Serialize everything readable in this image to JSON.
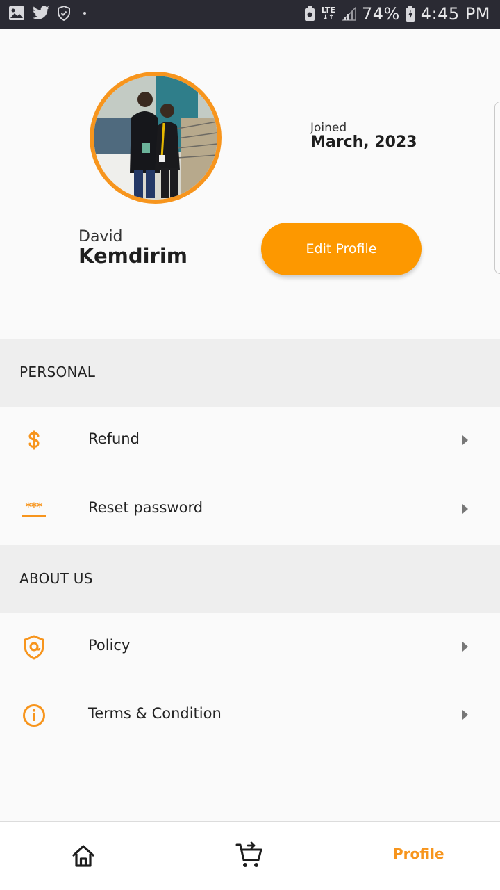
{
  "status_bar": {
    "network": "LTE",
    "battery_percent": "74%",
    "time": "4:45 PM"
  },
  "profile": {
    "joined_label": "Joined",
    "joined_date": "March, 2023",
    "first_name": "David",
    "last_name": "Kemdirim",
    "edit_button": "Edit Profile"
  },
  "sections": {
    "personal": {
      "title": "PERSONAL",
      "items": [
        {
          "label": "Refund",
          "icon": "dollar-icon"
        },
        {
          "label": "Reset password",
          "icon": "password-icon"
        }
      ]
    },
    "about": {
      "title": "ABOUT US",
      "items": [
        {
          "label": "Policy",
          "icon": "shield-icon"
        },
        {
          "label": "Terms & Condition",
          "icon": "info-icon"
        }
      ]
    }
  },
  "bottom_nav": {
    "home_icon": "home-icon",
    "cart_icon": "cart-icon",
    "profile_label": "Profile"
  },
  "colors": {
    "accent": "#fd9800",
    "section_bg": "#eeeeee",
    "status_bar_bg": "#2a2a33"
  }
}
